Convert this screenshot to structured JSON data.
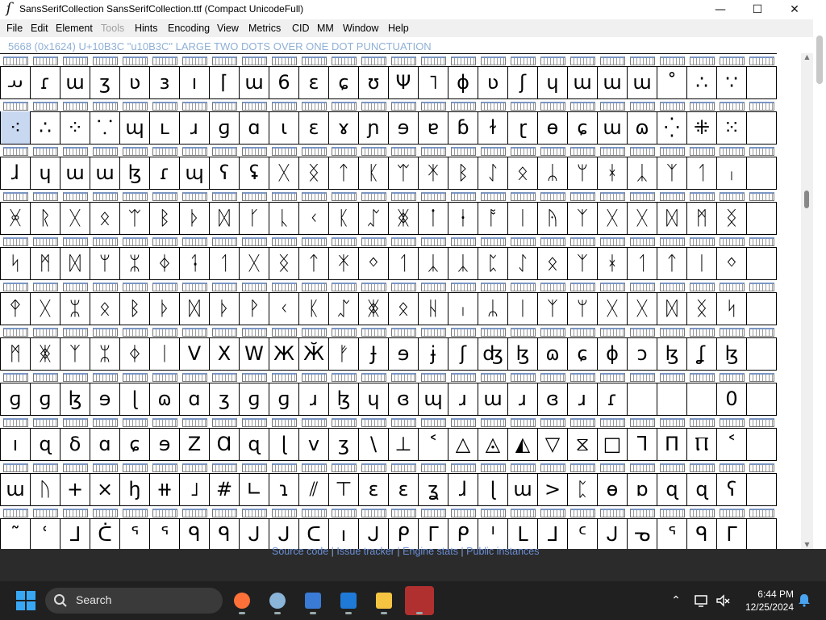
{
  "window": {
    "app_icon": "fontforge-icon",
    "title": "SansSerifCollection  SansSerifCollection.ttf (Compact UnicodeFull)",
    "minimize": "—",
    "maximize": "☐",
    "close": "✕"
  },
  "menu": [
    {
      "label": "File",
      "enabled": true
    },
    {
      "label": "Edit",
      "enabled": true
    },
    {
      "label": "Element",
      "enabled": true
    },
    {
      "label": "Tools",
      "enabled": false
    },
    {
      "label": "Hints",
      "enabled": true
    },
    {
      "label": "Encoding",
      "enabled": true
    },
    {
      "label": "View",
      "enabled": true
    },
    {
      "label": "Metrics",
      "enabled": true
    },
    {
      "label": "CID",
      "enabled": true
    },
    {
      "label": "MM",
      "enabled": true
    },
    {
      "label": "Window",
      "enabled": true
    },
    {
      "label": "Help",
      "enabled": true
    }
  ],
  "status": "5668 (0x1624) U+10B3C \"u10B3C\" LARGE TWO DOTS OVER ONE DOT PUNCTUATION",
  "grid": {
    "selected": {
      "row": 1,
      "col": 0
    },
    "rows": [
      [
        "𐬀",
        "ɾ",
        "ɯ",
        "ʒ",
        "ʋ",
        "ɜ",
        "ı",
        "⌈",
        "ɯ",
        "6",
        "ɛ",
        "ɕ",
        "ʊ",
        "Ψ",
        "˥",
        "ɸ",
        "ʋ",
        "ʃ",
        "ɥ",
        "ɯ",
        "ɯ",
        "ɯ",
        "˚",
        "∴",
        "∵"
      ],
      [
        "⁖",
        "∴",
        "⁘",
        "⸪",
        "ɰ",
        "ʟ",
        "ɹ",
        "ɡ",
        "ɑ",
        "ɩ",
        "ɛ",
        "ɤ",
        "ɲ",
        "ɘ",
        "ɐ",
        "ɓ",
        "ɫ",
        "ɽ",
        "ɵ",
        "ɕ",
        "ɯ",
        "ɷ",
        "⁛",
        "⁜",
        "⁙"
      ],
      [
        "ɺ",
        "ɥ",
        "ɯ",
        "ɯ",
        "ɮ",
        "ɾ",
        "ɰ",
        "ʕ",
        "ʢ",
        "ᚷ",
        "ᛝ",
        "ᛏ",
        "ᛕ",
        "ᛠ",
        "ᛡ",
        "ᛒ",
        "ᛇ",
        "ᛟ",
        "ᛦ",
        "ᛘ",
        "ᚼ",
        "ᛣ",
        "ᛉ",
        "ᛐ",
        "ᛧ"
      ],
      [
        "ᚸ",
        "ᚱ",
        "ᚷ",
        "ᛟ",
        "ᛠ",
        "ᛒ",
        "ᚦ",
        "ᛞ",
        "ᚴ",
        "ᚳ",
        "ᚲ",
        "ᛕ",
        "ᛢ",
        "ᛤ",
        "ᛙ",
        "ᚽ",
        "ᚩ",
        "ᛁ",
        "ᚤ",
        "ᛉ",
        "ᚷ",
        "ᚷ",
        "ᛞ",
        "ᛗ",
        "ᛝ"
      ],
      [
        "ᛋ",
        "ᛗ",
        "ᛞ",
        "ᛘ",
        "ᛯ",
        "ᛄ",
        "ᛑ",
        "ᛐ",
        "ᚷ",
        "ᛝ",
        "ᛏ",
        "ᛡ",
        "ᛜ",
        "ᛐ",
        "ᛣ",
        "ᛣ",
        "ᛈ",
        "ᛇ",
        "ᛟ",
        "ᛉ",
        "ᚼ",
        "ᛐ",
        "ᛏ",
        "ᛁ",
        "ᛜ"
      ],
      [
        "ᛳ",
        "ᚷ",
        "ᛯ",
        "ᛟ",
        "ᛒ",
        "ᚦ",
        "ᛞ",
        "ᚦ",
        "ᚹ",
        "ᚲ",
        "ᛕ",
        "ᛢ",
        "ᛤ",
        "ᛟ",
        "ᚺ",
        "ᛧ",
        "ᛦ",
        "ᛁ",
        "ᛉ",
        "ᛘ",
        "ᚷ",
        "ᚷ",
        "ᛞ",
        "ᛝ",
        "ᛋ"
      ],
      [
        "ᛗ",
        "ᛤ",
        "ᛉ",
        "ᛯ",
        "ᛄ",
        "ᛁ",
        "V",
        "X",
        "W",
        "Ж",
        "Ӂ",
        "ᚠ",
        "Ɉ",
        "ɘ",
        "ɉ",
        "ʃ",
        "ʤ",
        "ɮ",
        "ɷ",
        "ɕ",
        "ɸ",
        "ɔ",
        "ɮ",
        "ʆ",
        "ɮ"
      ],
      [
        "ɡ",
        "ɡ",
        "ɮ",
        "ɘ",
        "ɭ",
        "ɷ",
        "ɑ",
        "ʒ",
        "ɡ",
        "ɡ",
        "ɹ",
        "ɮ",
        "ɥ",
        "ɞ",
        "ɰ",
        "ɹ",
        "ɯ",
        "ɹ",
        "ɞ",
        "ɹ",
        "ɾ",
        "",
        "",
        "",
        "0"
      ],
      [
        "ı",
        "ɋ",
        "δ",
        "ɑ",
        "ɕ",
        "ɘ",
        "Z",
        "Ɑ",
        "ɋ",
        "ɭ",
        "v",
        "ʒ",
        "\\",
        "⊥",
        "˂",
        "△",
        "◬",
        "◭",
        "▽",
        "⧖",
        "□",
        "ᒣ",
        "Π",
        "Ⲡ",
        "˂"
      ],
      [
        "ɯ",
        "ᚢ",
        "+",
        "×",
        "ꜧ",
        "⧺",
        "˩",
        "#",
        "∟",
        "ɿ",
        "⫽",
        "⊤",
        "ɛ",
        "ɛ",
        "ʓ",
        "ɺ",
        "ɭ",
        "ɯ",
        ">",
        "ᛈ",
        "ɵ",
        "ɒ",
        "ɋ",
        "ɋ",
        "ʕ"
      ],
      [
        "˜",
        "ʿ",
        "ᒧ",
        "ᑖ",
        "ᕐ",
        "ᕐ",
        "ᑫ",
        "ᑫ",
        "ᒍ",
        "ᒍ",
        "ᑕ",
        "ı",
        "ᒍ",
        "ᑭ",
        "ᒥ",
        "ᑭ",
        "ᑊ",
        "ᒪ",
        "ᒧ",
        "ᑦ",
        "ᒍ",
        "ᓀ",
        "ᕐ",
        "ᑫ",
        "ᒥ"
      ]
    ]
  },
  "web_links": [
    "Source code",
    "Issue tracker",
    "Engine stats",
    "Public instances"
  ],
  "taskbar": {
    "search_placeholder": "Search",
    "apps": [
      {
        "name": "firefox-icon",
        "color": "#ff7139"
      },
      {
        "name": "settings-icon",
        "color": "#8ab4d8"
      },
      {
        "name": "photos-icon",
        "color": "#3a7bd5"
      },
      {
        "name": "defender-icon",
        "color": "#1e7ad6"
      },
      {
        "name": "file-explorer-icon",
        "color": "#f5c542"
      },
      {
        "name": "fontforge-app-icon",
        "color": "#b0302f"
      }
    ],
    "time": "6:44 PM",
    "date": "12/25/2024"
  }
}
